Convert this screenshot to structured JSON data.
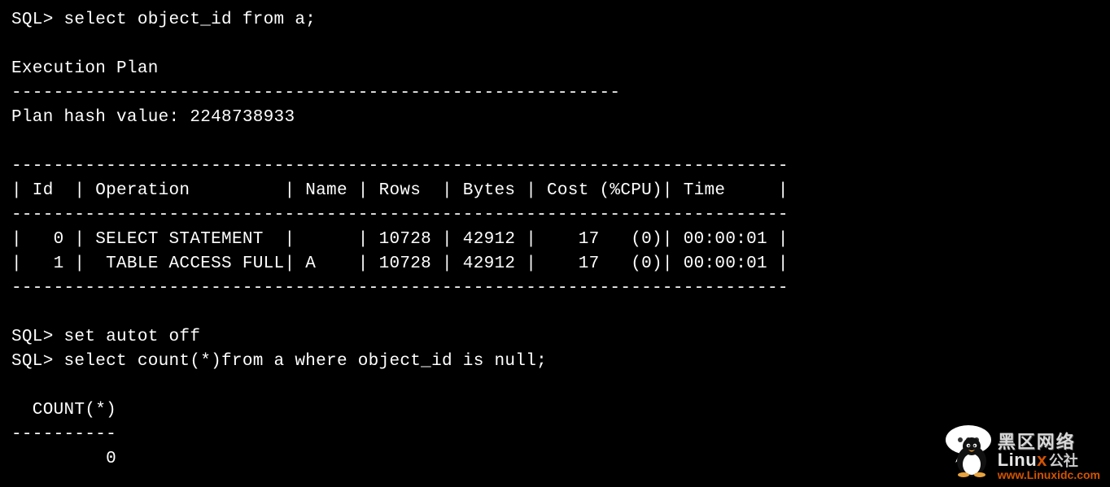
{
  "lines": {
    "l0": "SQL> select object_id from a;",
    "l1": "",
    "l2": "Execution Plan",
    "l3": "----------------------------------------------------------",
    "l4": "Plan hash value: 2248738933",
    "l5": "",
    "l6": "--------------------------------------------------------------------------",
    "l7": "| Id  | Operation         | Name | Rows  | Bytes | Cost (%CPU)| Time     |",
    "l8": "--------------------------------------------------------------------------",
    "l9": "|   0 | SELECT STATEMENT  |      | 10728 | 42912 |    17   (0)| 00:00:01 |",
    "l10": "|   1 |  TABLE ACCESS FULL| A    | 10728 | 42912 |    17   (0)| 00:00:01 |",
    "l11": "--------------------------------------------------------------------------",
    "l12": "",
    "l13": "SQL> set autot off",
    "l14": "SQL> select count(*)from a where object_id is null;",
    "l15": "",
    "l16": "  COUNT(*)",
    "l17": "----------",
    "l18": "         0"
  },
  "execution_plan": {
    "hash_value": "2248738933",
    "columns": [
      "Id",
      "Operation",
      "Name",
      "Rows",
      "Bytes",
      "Cost (%CPU)",
      "Time"
    ],
    "rows": [
      {
        "Id": 0,
        "Operation": "SELECT STATEMENT",
        "Name": "",
        "Rows": 10728,
        "Bytes": 42912,
        "Cost": 17,
        "CPU": 0,
        "Time": "00:00:01"
      },
      {
        "Id": 1,
        "Operation": "TABLE ACCESS FULL",
        "Name": "A",
        "Rows": 10728,
        "Bytes": 42912,
        "Cost": 17,
        "CPU": 0,
        "Time": "00:00:01"
      }
    ]
  },
  "query_result": {
    "column": "COUNT(*)",
    "value": 0
  },
  "watermark": {
    "chinese": "黑区网络",
    "brand_prefix": "Linu",
    "brand_x": "x",
    "gongshe": "公社",
    "url": "www.Linuxidc.com"
  }
}
